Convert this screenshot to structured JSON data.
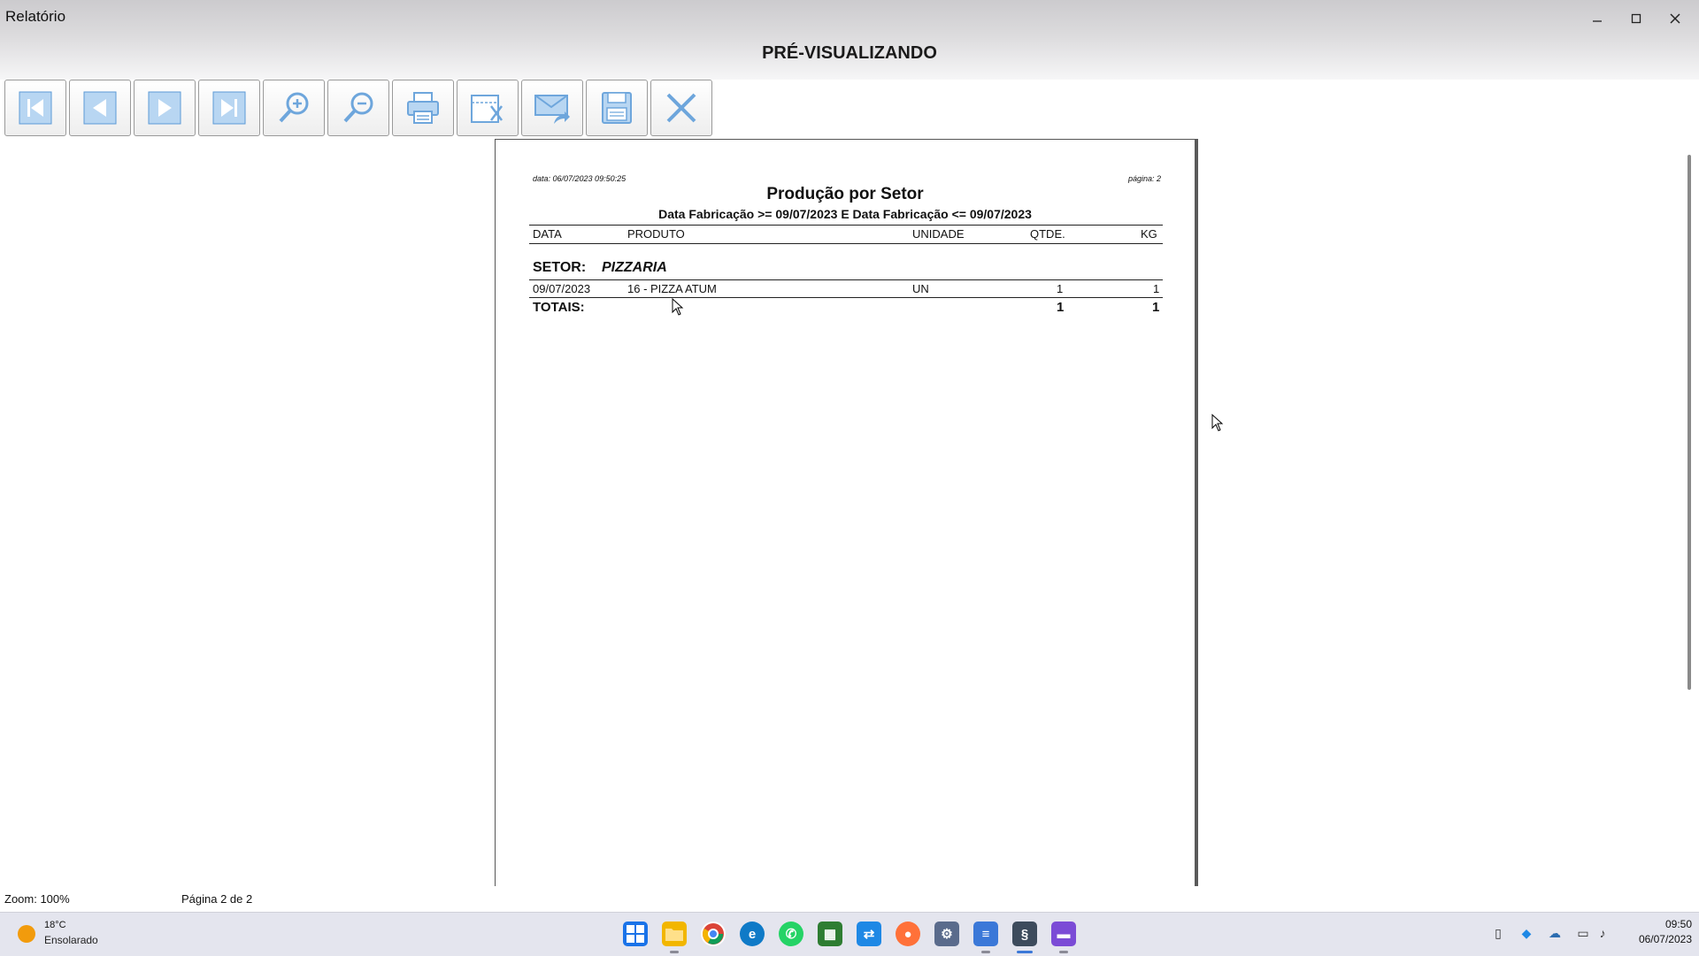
{
  "window": {
    "title": "Relatório",
    "minimize_icon": "minimize-icon",
    "maximize_icon": "maximize-icon",
    "close_icon": "close-icon"
  },
  "preview": {
    "title": "PRÉ-VISUALIZANDO"
  },
  "toolbar": {
    "buttons": [
      {
        "name": "first-page-button",
        "icon": "first-page-icon"
      },
      {
        "name": "previous-page-button",
        "icon": "previous-page-icon"
      },
      {
        "name": "next-page-button",
        "icon": "next-page-icon"
      },
      {
        "name": "last-page-button",
        "icon": "last-page-icon"
      },
      {
        "name": "zoom-in-button",
        "icon": "zoom-in-icon"
      },
      {
        "name": "zoom-out-button",
        "icon": "zoom-out-icon"
      },
      {
        "name": "print-button",
        "icon": "printer-icon"
      },
      {
        "name": "page-setup-button",
        "icon": "page-setup-icon"
      },
      {
        "name": "email-button",
        "icon": "email-icon"
      },
      {
        "name": "save-button",
        "icon": "floppy-disk-icon"
      },
      {
        "name": "close-preview-button",
        "icon": "close-icon"
      }
    ]
  },
  "report": {
    "date_label": "data: 06/07/2023 09:50:25",
    "page_label": "página: 2",
    "title": "Produção por Setor",
    "filter": "Data Fabricação >= 09/07/2023 E Data Fabricação <= 09/07/2023",
    "columns": {
      "date": "DATA",
      "product": "PRODUTO",
      "unit": "UNIDADE",
      "qty": "QTDE.",
      "kg": "KG"
    },
    "sector_label": "SETOR:",
    "sector_name": "PIZZARIA",
    "rows": [
      {
        "date": "09/07/2023",
        "product": "16 - PIZZA ATUM",
        "unit": "UN",
        "qty": "1",
        "kg": "1"
      }
    ],
    "totals_label": "TOTAIS:",
    "totals_qty": "1",
    "totals_kg": "1"
  },
  "status": {
    "zoom": "Zoom: 100%",
    "page": "Página 2 de 2"
  },
  "taskbar": {
    "weather_temp": "18°C",
    "weather_desc": "Ensolarado",
    "weather_icon": "sun-icon",
    "apps": [
      {
        "name": "start-button",
        "icon": "windows-start-icon",
        "color": "#1a73e8"
      },
      {
        "name": "file-explorer-button",
        "icon": "folder-icon",
        "color": "#f2b600"
      },
      {
        "name": "chrome-button",
        "icon": "chrome-icon",
        "color": "#db4437"
      },
      {
        "name": "edge-button",
        "icon": "edge-icon",
        "color": "#0f7ac7"
      },
      {
        "name": "whatsapp-button",
        "icon": "whatsapp-icon",
        "color": "#25d366"
      },
      {
        "name": "spreadsheet-app-button",
        "icon": "spreadsheet-icon",
        "color": "#2e7d32"
      },
      {
        "name": "remote-app-button",
        "icon": "remote-desktop-icon",
        "color": "#1e88e5"
      },
      {
        "name": "firefox-button",
        "icon": "firefox-icon",
        "color": "#ff7139"
      },
      {
        "name": "settings-button",
        "icon": "gear-icon",
        "color": "#5a6b8c"
      },
      {
        "name": "notepad-button",
        "icon": "notepad-icon",
        "color": "#3b78d8"
      },
      {
        "name": "erp-app-button",
        "icon": "erp-app-icon",
        "color": "#3d4b5c"
      },
      {
        "name": "media-app-button",
        "icon": "media-app-icon",
        "color": "#7b4bd6"
      }
    ],
    "time": "09:50",
    "date": "06/07/2023"
  }
}
